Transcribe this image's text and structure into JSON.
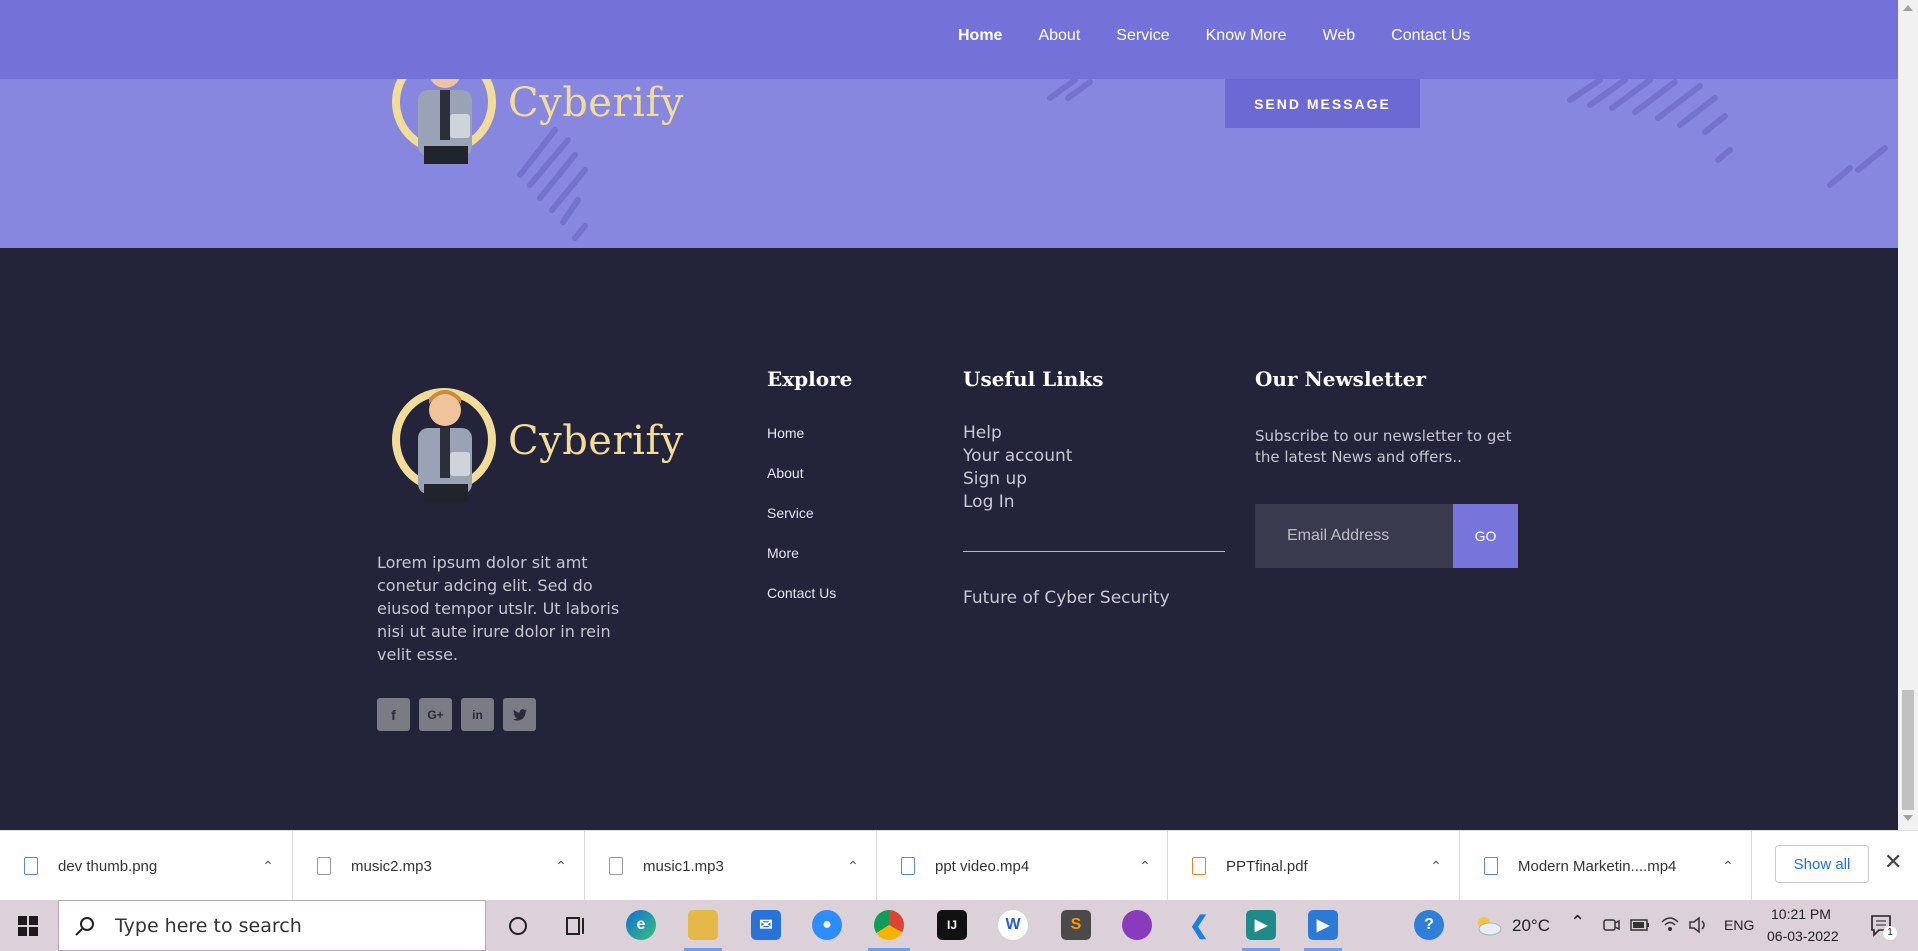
{
  "nav": {
    "items": [
      "Home",
      "About",
      "Service",
      "Know More",
      "Web",
      "Contact Us"
    ]
  },
  "brand": {
    "name": "Cyberify"
  },
  "hero": {
    "send_label": "SEND MESSAGE"
  },
  "footer": {
    "about_text": "Lorem ipsum dolor sit amt conetur adcing elit. Sed do eiusod tempor utslr. Ut laboris nisi ut aute irure dolor in rein velit esse.",
    "social": [
      "facebook-icon",
      "google-plus-icon",
      "linkedin-icon",
      "twitter-icon"
    ],
    "explore": {
      "title": "Explore",
      "links": [
        "Home",
        "About",
        "Service",
        "More",
        "Contact Us"
      ]
    },
    "useful": {
      "title": "Useful Links",
      "links": [
        "Help",
        "Your account",
        "Sign up",
        "Log In"
      ],
      "extra": "Future of Cyber Security"
    },
    "newsletter": {
      "title": "Our Newsletter",
      "text": "Subscribe to our newsletter to get the latest News and offers..",
      "placeholder": "Email Address",
      "go_label": "GO"
    }
  },
  "downloads": {
    "items": [
      "dev thumb.png",
      "music2.mp3",
      "music1.mp3",
      "ppt video.mp4",
      "PPTfinal.pdf",
      "Modern Marketin....mp4"
    ],
    "show_all": "Show all"
  },
  "taskbar": {
    "search_placeholder": "Type here to search",
    "weather": "20°C",
    "lang": "ENG",
    "time": "10:21 PM",
    "date": "06-03-2022",
    "notif_count": "1"
  }
}
